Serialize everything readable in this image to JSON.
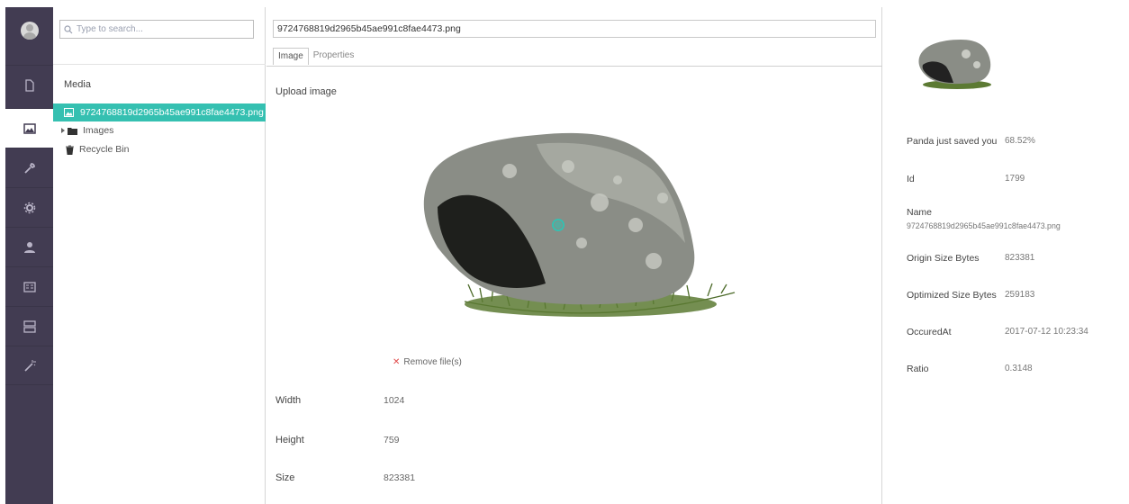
{
  "rail": {
    "items": [
      {
        "icon": "document-icon"
      },
      {
        "icon": "image-icon",
        "active": true
      },
      {
        "icon": "wrench-icon"
      },
      {
        "icon": "gear-icon"
      },
      {
        "icon": "user-icon"
      },
      {
        "icon": "id-card-icon"
      },
      {
        "icon": "form-icon"
      },
      {
        "icon": "magic-wand-icon"
      }
    ]
  },
  "tree": {
    "search_placeholder": "Type to search...",
    "section_title": "Media",
    "selected_item": "9724768819d2965b45ae991c8fae4473.png",
    "folder_item": "Images",
    "recycle_item": "Recycle Bin"
  },
  "editor": {
    "name_value": "9724768819d2965b45ae991c8fae4473.png",
    "tabs": [
      {
        "label": "Image",
        "active": true
      },
      {
        "label": "Properties",
        "active": false
      }
    ],
    "upload_label": "Upload image",
    "remove_link": "Remove file(s)",
    "properties": [
      {
        "label": "Width",
        "value": "1024"
      },
      {
        "label": "Height",
        "value": "759"
      },
      {
        "label": "Size",
        "value": "823381"
      }
    ]
  },
  "info": {
    "rows": [
      {
        "label": "Panda just saved you",
        "value": "68.52%"
      },
      {
        "label": "Id",
        "value": "1799"
      },
      {
        "label": "Name",
        "value": "9724768819d2965b45ae991c8fae4473.png"
      },
      {
        "label": "Origin Size Bytes",
        "value": "823381"
      },
      {
        "label": "Optimized Size Bytes",
        "value": "259183"
      },
      {
        "label": "OccuredAt",
        "value": "2017-07-12 10:23:34"
      },
      {
        "label": "Ratio",
        "value": "0.3148"
      }
    ]
  },
  "colors": {
    "rail": "#423c52",
    "accent": "#35c0b1",
    "remove": "#e04a4a"
  }
}
